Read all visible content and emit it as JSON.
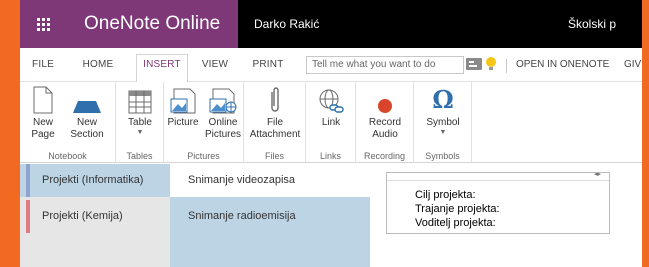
{
  "titlebar": {
    "app_name": "OneNote Online",
    "user_name": "Darko Rakić",
    "school_name": "Školski p"
  },
  "tabs": [
    {
      "label": "FILE",
      "active": false
    },
    {
      "label": "HOME",
      "active": false
    },
    {
      "label": "INSERT",
      "active": true
    },
    {
      "label": "VIEW",
      "active": false
    },
    {
      "label": "PRINT",
      "active": false
    }
  ],
  "tell_me": {
    "placeholder": "Tell me what you want to do"
  },
  "open_in_onenote": "OPEN IN ONENOTE",
  "give_feedback": "GIV",
  "ribbon": {
    "groups": [
      {
        "label": "Notebook"
      },
      {
        "label": "Tables"
      },
      {
        "label": "Pictures"
      },
      {
        "label": "Files"
      },
      {
        "label": "Links"
      },
      {
        "label": "Recording"
      },
      {
        "label": "Symbols"
      }
    ],
    "buttons": {
      "new_page": [
        "New",
        "Page"
      ],
      "new_section": [
        "New",
        "Section"
      ],
      "table": "Table",
      "picture": "Picture",
      "online_pictures": [
        "Online",
        "Pictures"
      ],
      "file_attachment": [
        "File",
        "Attachment"
      ],
      "link": "Link",
      "record_audio": [
        "Record",
        "Audio"
      ],
      "symbol": "Symbol"
    }
  },
  "sections": [
    {
      "label": "Projekti (Informatika)",
      "color": "#8ea3cf",
      "active": true
    },
    {
      "label": "Projekti (Kemija)",
      "color": "#e07b86",
      "active": false
    }
  ],
  "pages": [
    {
      "label": "Snimanje videozapisa",
      "active": true
    },
    {
      "label": "Snimanje radioemisija",
      "active": false
    }
  ],
  "note": {
    "lines": [
      "Cilj projekta:",
      "Trajanje projekta:",
      "Voditelj projekta:"
    ]
  },
  "colors": {
    "accent": "#7e3878",
    "titlebar": "#000000",
    "frame": "#f26a21",
    "pages_pane": "#bdd4e5",
    "sections_pane": "#e6e6e6"
  }
}
